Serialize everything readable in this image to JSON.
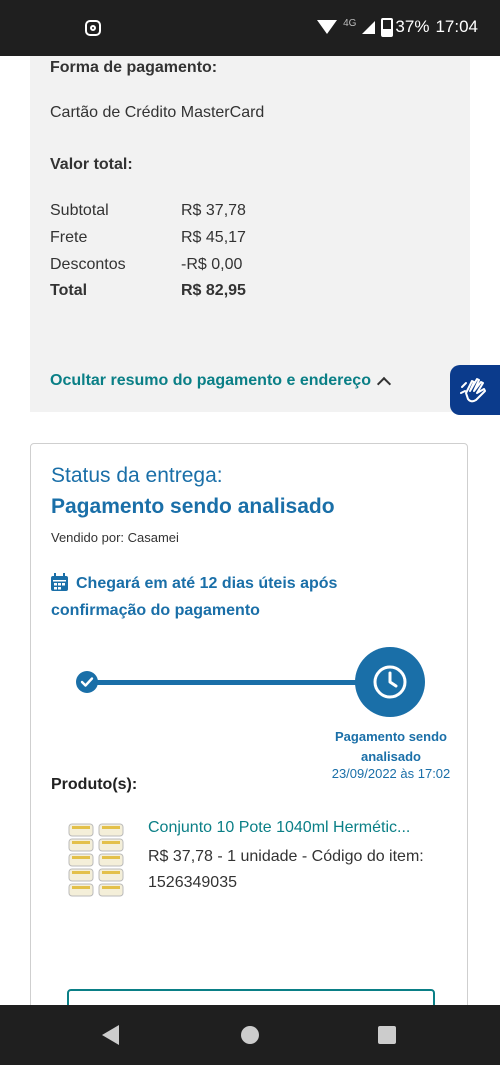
{
  "statusbar": {
    "network": "4G",
    "battery": "37%",
    "time": "17:04"
  },
  "summary": {
    "payment_method_label": "Forma de pagamento:",
    "payment_method_value": "Cartão de Crédito MasterCard",
    "total_value_label": "Valor total:",
    "rows": [
      {
        "label": "Subtotal",
        "value": "R$ 37,78"
      },
      {
        "label": "Frete",
        "value": "R$ 45,17"
      },
      {
        "label": "Descontos",
        "value": "-R$ 0,00"
      },
      {
        "label": "Total",
        "value": "R$ 82,95"
      }
    ],
    "hide_link": "Ocultar resumo do pagamento e endereço"
  },
  "delivery": {
    "status_label": "Status da entrega:",
    "status_value": "Pagamento sendo analisado",
    "seller": "Vendido por: Casamei",
    "eta": "Chegará em até 12 dias úteis após confirmação do pagamento",
    "timeline_label": "Pagamento sendo analisado",
    "timeline_date": "23/09/2022 às 17:02"
  },
  "products": {
    "label": "Produto(s):",
    "items": [
      {
        "name": "Conjunto 10 Pote 1040ml Hermétic...",
        "description": "R$ 37,78 - 1 unidade - Código do item: 1526349035"
      }
    ]
  },
  "colors": {
    "accent_blue": "#1a6fa8",
    "accent_teal": "#0a7f86",
    "libras_blue": "#0b3b8c"
  }
}
